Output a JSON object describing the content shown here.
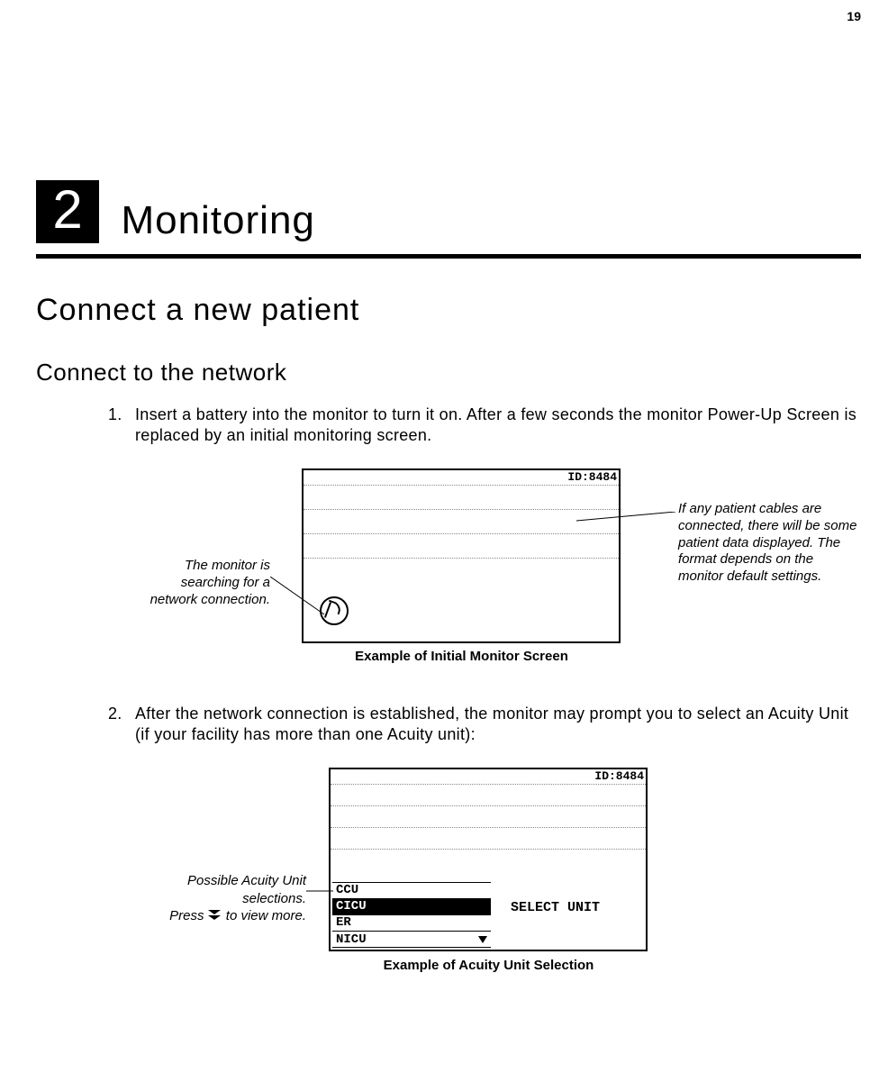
{
  "page_number": "19",
  "chapter": {
    "number": "2",
    "title": "Monitoring"
  },
  "section_title": "Connect a new patient",
  "subsection_title": "Connect to the network",
  "steps": {
    "s1_num": "1.",
    "s1_text": "Insert a battery into the monitor to turn it on. After a few seconds the monitor Power-Up Screen is replaced by an initial monitoring screen.",
    "s2_num": "2.",
    "s2_text": "After the network connection is established, the monitor may prompt you to select an Acuity Unit (if your facility has more than one Acuity unit):"
  },
  "fig1": {
    "id_label": "ID:8484",
    "callout_left": "The monitor is searching for a network connection.",
    "callout_right": "If any patient cables are connected, there will be some patient data displayed. The format depends on the monitor default settings.",
    "caption": "Example of Initial Monitor Screen"
  },
  "fig2": {
    "id_label": "ID:8484",
    "select_label": "SELECT UNIT",
    "units": {
      "u0": "CCU",
      "u1": "CICU",
      "u2": "ER",
      "u3": "NICU"
    },
    "callout_left_line1": "Possible Acuity Unit selections.",
    "callout_left_line2_a": "Press",
    "callout_left_line2_b": "to view more.",
    "caption": "Example of Acuity Unit Selection"
  }
}
